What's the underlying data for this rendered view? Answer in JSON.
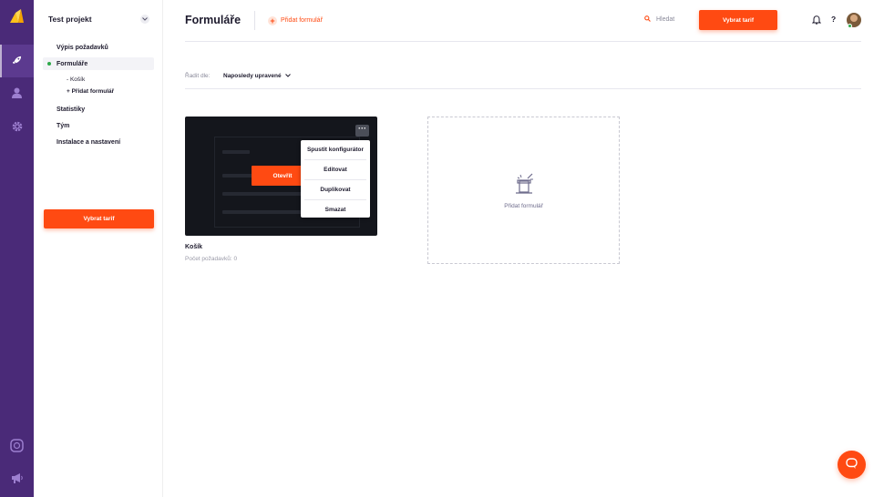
{
  "rail": {
    "items": [
      {
        "name": "logo",
        "icon": "brand-logo-icon"
      },
      {
        "name": "forms",
        "icon": "rocket-icon",
        "active": true
      },
      {
        "name": "users",
        "icon": "user-icon"
      },
      {
        "name": "settings",
        "icon": "gear-icon"
      },
      {
        "name": "support-center",
        "icon": "lifebuoy-icon"
      },
      {
        "name": "announcements",
        "icon": "megaphone-icon"
      }
    ]
  },
  "sidebar": {
    "project_title": "Test projekt",
    "nav": {
      "requests": "Výpis požadavků",
      "forms": "Formuláře",
      "forms_sub_1": "- Košík",
      "forms_sub_2": "+ Přidat formulář",
      "stats": "Statistiky",
      "team": "Tým",
      "install": "Instalace a nastavení"
    },
    "cta": "Vybrat tarif"
  },
  "header": {
    "title": "Formuláře",
    "add_form": "Přidat formulář",
    "search": "Hledat",
    "cta": "Vybrat tarif",
    "help": "?"
  },
  "sort": {
    "label": "Řadit dle:",
    "value": "Naposledy upravené"
  },
  "form_card": {
    "name": "Košík",
    "count": "Počet požadavků: 0",
    "open_label": "Otevřít",
    "more_label": "···",
    "menu": {
      "run": "Spustit konfigurátor",
      "edit": "Editovat",
      "duplicate": "Duplikovat",
      "delete": "Smazat"
    }
  },
  "add_tile": {
    "label": "Přidat formulář"
  },
  "colors": {
    "accent": "#ff4a12",
    "rail": "#4a2a78",
    "success": "#2ea84a"
  }
}
